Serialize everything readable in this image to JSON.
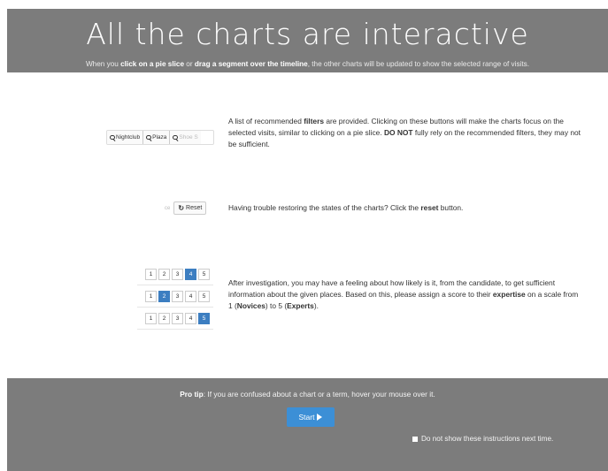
{
  "hero": {
    "title": "All the charts are interactive",
    "sub_a": "When you ",
    "sub_b": "click on a pie slice",
    "sub_c": " or ",
    "sub_d": "drag a segment over the timeline",
    "sub_e": ", the other charts will be updated to show the selected range of visits."
  },
  "filters": {
    "buttons": [
      "Nightclub",
      "Plaza",
      "Shoe S"
    ],
    "desc_a": "A list of recommended ",
    "desc_b": "filters",
    "desc_c": " are provided. Clicking on these buttons will make the charts focus on the selected visits, similar to clicking on a pie slice. ",
    "desc_d": "DO NOT",
    "desc_e": " fully rely on the recommended filters, they may not be sufficient."
  },
  "reset": {
    "fade_text": "ce",
    "button_label": "Reset",
    "desc_a": "Having trouble restoring the states of the charts? Click the ",
    "desc_b": "reset",
    "desc_c": " button."
  },
  "expertise": {
    "scale_values": [
      "1",
      "2",
      "3",
      "4",
      "5"
    ],
    "selected_in_rows": [
      4,
      2,
      5
    ],
    "desc_a": "After investigation, you may have a feeling about how likely is it, from the candidate, to get sufficient information about the given places. Based on this, please assign a score to their ",
    "desc_b": "expertise",
    "desc_c": " on a scale from 1 (",
    "desc_d": "Novices",
    "desc_e": ") to 5 (",
    "desc_f": "Experts",
    "desc_g": ")."
  },
  "footer": {
    "protip_label": "Pro tip",
    "protip_text": ": If you are confused about a chart or a term, hover your mouse over it.",
    "start_label": "Start",
    "dont_show_label": "Do not show these instructions next time."
  },
  "colors": {
    "panel": "#7c7c7c",
    "accent": "#3c8fd6",
    "selected": "#3c7ec1"
  }
}
